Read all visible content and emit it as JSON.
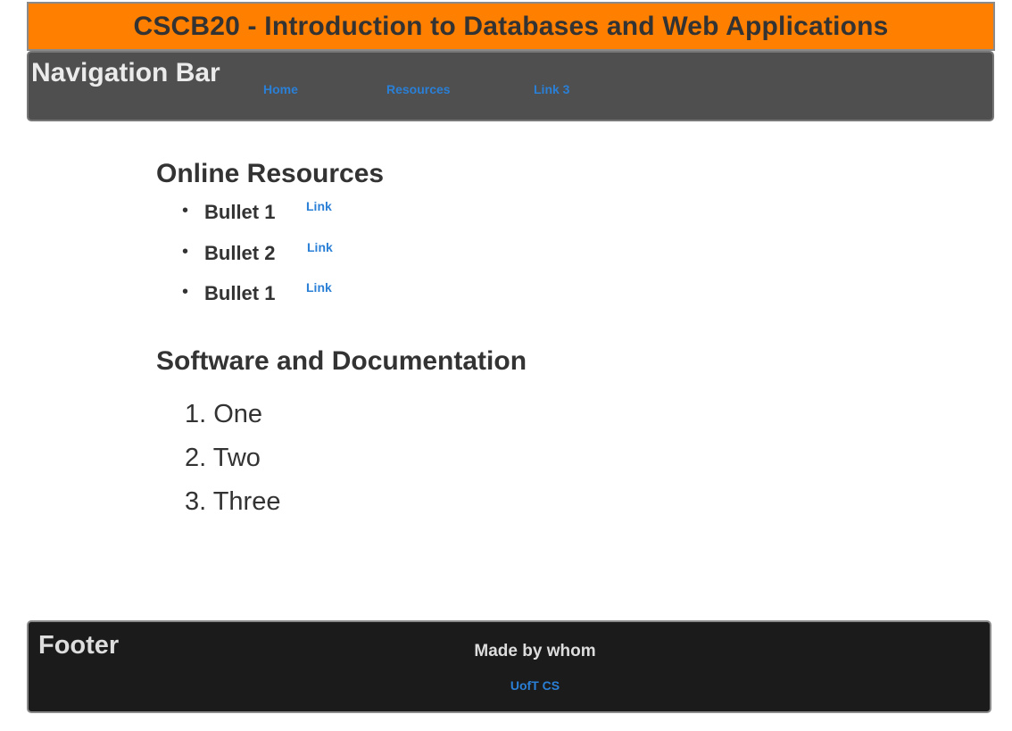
{
  "header": {
    "title": "CSCB20 - Introduction to Databases and Web Applications"
  },
  "navbar": {
    "title": "Navigation Bar",
    "links": [
      {
        "label": "Home"
      },
      {
        "label": "Resources"
      },
      {
        "label": "Link 3"
      }
    ]
  },
  "main": {
    "online_resources": {
      "heading": "Online Resources",
      "items": [
        {
          "text": "Bullet 1",
          "link": "Link"
        },
        {
          "text": "Bullet 2",
          "link": "Link"
        },
        {
          "text": "Bullet 1",
          "link": "Link"
        }
      ]
    },
    "software": {
      "heading": "Software and Documentation",
      "items": [
        "1. One",
        "2. Two",
        "3. Three"
      ]
    }
  },
  "footer": {
    "title": "Footer",
    "made_by": "Made by whom",
    "link": "UofT CS"
  },
  "colors": {
    "header_bg": "#ff7f00",
    "navbar_bg": "#4f4f4f",
    "footer_bg": "#1b1b1b",
    "link": "#2a7fd6",
    "text": "#333333"
  }
}
